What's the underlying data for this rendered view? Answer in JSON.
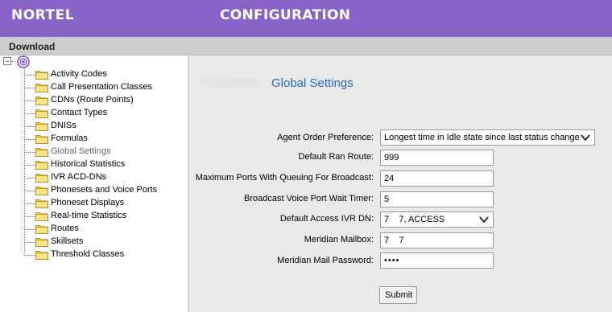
{
  "header": {
    "brand": "NORTEL",
    "title": "CONFIGURATION"
  },
  "menubar": {
    "download": "Download"
  },
  "tree": {
    "root_toggle": "−",
    "items": [
      {
        "label": "Activity Codes"
      },
      {
        "label": "Call Presentation Classes"
      },
      {
        "label": "CDNs (Route Points)"
      },
      {
        "label": "Contact Types"
      },
      {
        "label": "DNISs"
      },
      {
        "label": "Formulas"
      },
      {
        "label": "Global Settings"
      },
      {
        "label": "Historical Statistics"
      },
      {
        "label": "IVR ACD-DNs"
      },
      {
        "label": "Phonesets and Voice Ports"
      },
      {
        "label": "Phoneset Displays"
      },
      {
        "label": "Real-time Statistics"
      },
      {
        "label": "Routes"
      },
      {
        "label": "Skillsets"
      },
      {
        "label": "Threshold Classes"
      }
    ]
  },
  "page": {
    "title": "Global Settings"
  },
  "form": {
    "agent_order": {
      "label": "Agent Order Preference:",
      "value": "Longest time in Idle state since last status change"
    },
    "default_ran_route": {
      "label": "Default Ran Route:",
      "value": "999"
    },
    "max_ports": {
      "label": "Maximum Ports With Queuing For Broadcast:",
      "value": "24"
    },
    "broadcast_wait": {
      "label": "Broadcast Voice Port Wait Timer:",
      "value": "5"
    },
    "default_ivr_dn": {
      "label": "Default Access IVR DN:",
      "value": "7    7, ACCESS"
    },
    "meridian_mailbox": {
      "label": "Meridian Mailbox:",
      "value": "7    7"
    },
    "meridian_password": {
      "label": "Meridian Mail Password:",
      "value": "••••"
    },
    "submit": "Submit"
  },
  "colors": {
    "header_bg": "#8a63c9",
    "title": "#2a6ac0",
    "menubar_bg": "#cdcdcd"
  }
}
